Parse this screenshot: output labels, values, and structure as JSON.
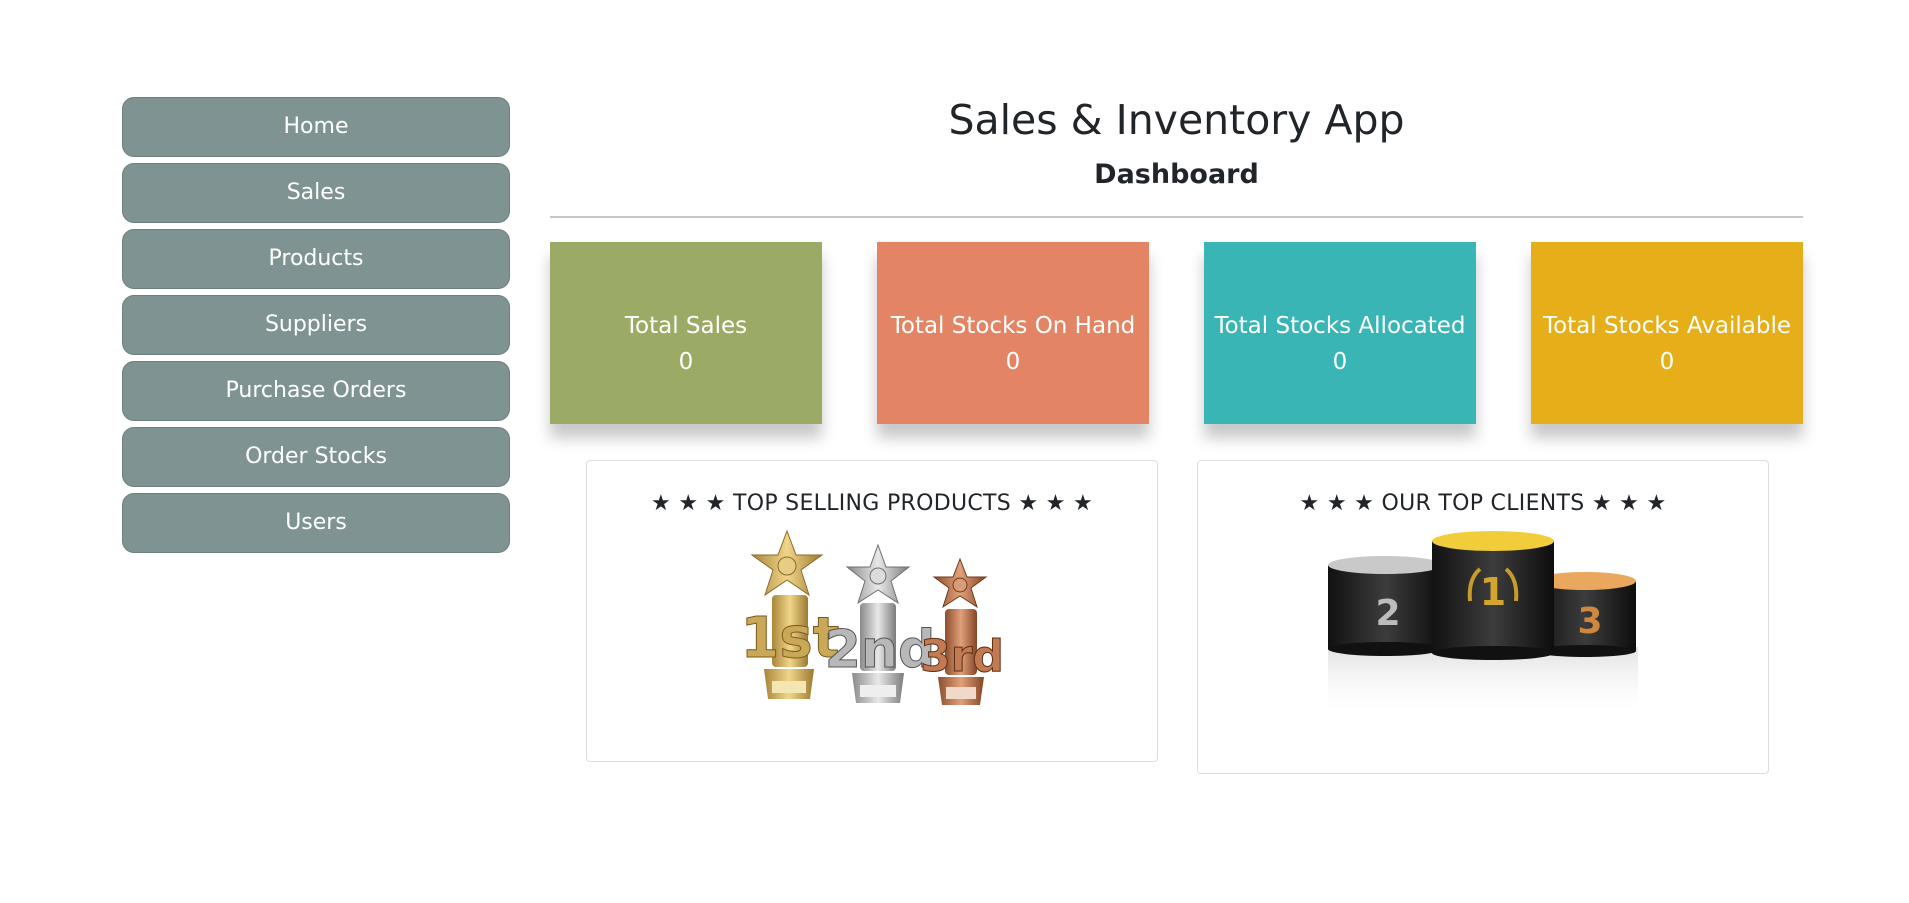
{
  "sidebar": {
    "items": [
      {
        "label": "Home"
      },
      {
        "label": "Sales"
      },
      {
        "label": "Products"
      },
      {
        "label": "Suppliers"
      },
      {
        "label": "Purchase Orders"
      },
      {
        "label": "Order Stocks"
      },
      {
        "label": "Users"
      }
    ]
  },
  "header": {
    "title": "Sales & Inventory App",
    "subtitle": "Dashboard"
  },
  "stats": [
    {
      "label": "Total Sales",
      "value": "0",
      "color": "#9bab66"
    },
    {
      "label": "Total Stocks On Hand",
      "value": "0",
      "color": "#e38465"
    },
    {
      "label": "Total Stocks Allocated",
      "value": "0",
      "color": "#38b5b4"
    },
    {
      "label": "Total Stocks Available",
      "value": "0",
      "color": "#e6af19"
    }
  ],
  "panels": {
    "top_products": {
      "title": "★ ★ ★ TOP SELLING PRODUCTS ★ ★ ★",
      "trophy_labels": [
        "1st",
        "2nd",
        "3rd"
      ]
    },
    "top_clients": {
      "title": "★ ★ ★ OUR TOP CLIENTS ★ ★ ★",
      "podium_labels": [
        "2",
        "1",
        "3"
      ]
    }
  },
  "colors": {
    "nav_button": "#7f9492",
    "gold": "#d8b24a",
    "silver": "#b5b5b5",
    "bronze": "#c17a4d"
  }
}
